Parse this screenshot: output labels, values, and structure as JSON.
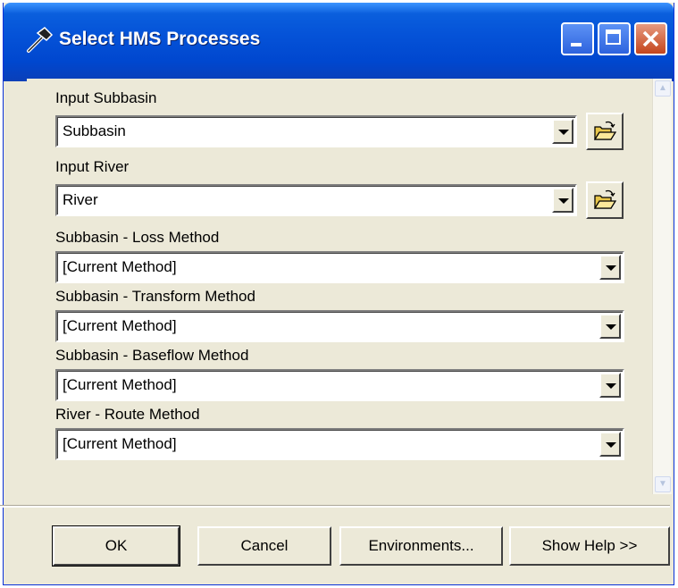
{
  "window": {
    "title": "Select HMS Processes",
    "icon": "hammer-icon",
    "controls": {
      "minimize": "minimize-icon",
      "maximize": "maximize-icon",
      "close": "close-icon"
    }
  },
  "form": {
    "input_subbasin": {
      "label": "Input Subbasin",
      "value": "Subbasin"
    },
    "input_river": {
      "label": "Input River",
      "value": "River"
    },
    "loss_method": {
      "label": "Subbasin - Loss Method",
      "value": "[Current Method]"
    },
    "transform_method": {
      "label": "Subbasin - Transform Method",
      "value": "[Current Method]"
    },
    "baseflow_method": {
      "label": "Subbasin - Baseflow Method",
      "value": "[Current Method]"
    },
    "route_method": {
      "label": "River - Route Method",
      "value": "[Current Method]"
    }
  },
  "buttons": {
    "ok": "OK",
    "cancel": "Cancel",
    "environments": "Environments...",
    "show_help": "Show Help >>"
  },
  "colors": {
    "titlebar": "#0553d8",
    "dialog_bg": "#ece9d8",
    "close_button": "#c4451c"
  }
}
